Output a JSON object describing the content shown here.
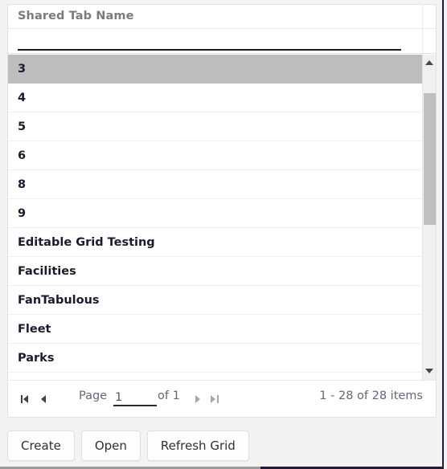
{
  "grid": {
    "column_header": "Shared Tab Name",
    "filter": {
      "value": "",
      "placeholder": ""
    },
    "rows": [
      {
        "name": "3",
        "selected": true
      },
      {
        "name": "4",
        "selected": false
      },
      {
        "name": "5",
        "selected": false
      },
      {
        "name": "6",
        "selected": false
      },
      {
        "name": "8",
        "selected": false
      },
      {
        "name": "9",
        "selected": false
      },
      {
        "name": "Editable Grid Testing",
        "selected": false
      },
      {
        "name": "Facilities",
        "selected": false
      },
      {
        "name": "FanTabulous",
        "selected": false
      },
      {
        "name": "Fleet",
        "selected": false
      },
      {
        "name": "Parks",
        "selected": false
      }
    ],
    "scrollbar": {
      "up_icon": "triangle-up-icon",
      "down_icon": "triangle-down-icon"
    }
  },
  "pager": {
    "first_icon": "go-to-first-page-icon",
    "prev_icon": "go-to-previous-page-icon",
    "next_icon": "go-to-next-page-icon",
    "last_icon": "go-to-last-page-icon",
    "page_label": "Page",
    "page_value": "1",
    "of_label": "of 1",
    "items_info": "1 - 28 of 28 items"
  },
  "actions": {
    "create": "Create",
    "open": "Open",
    "refresh": "Refresh Grid"
  },
  "colors": {
    "selected_row": "#bebebe",
    "header_text": "#7b7b7b",
    "pager_text": "#6b6478",
    "row_text": "#1b1b2b",
    "page_edge": "#231933"
  }
}
